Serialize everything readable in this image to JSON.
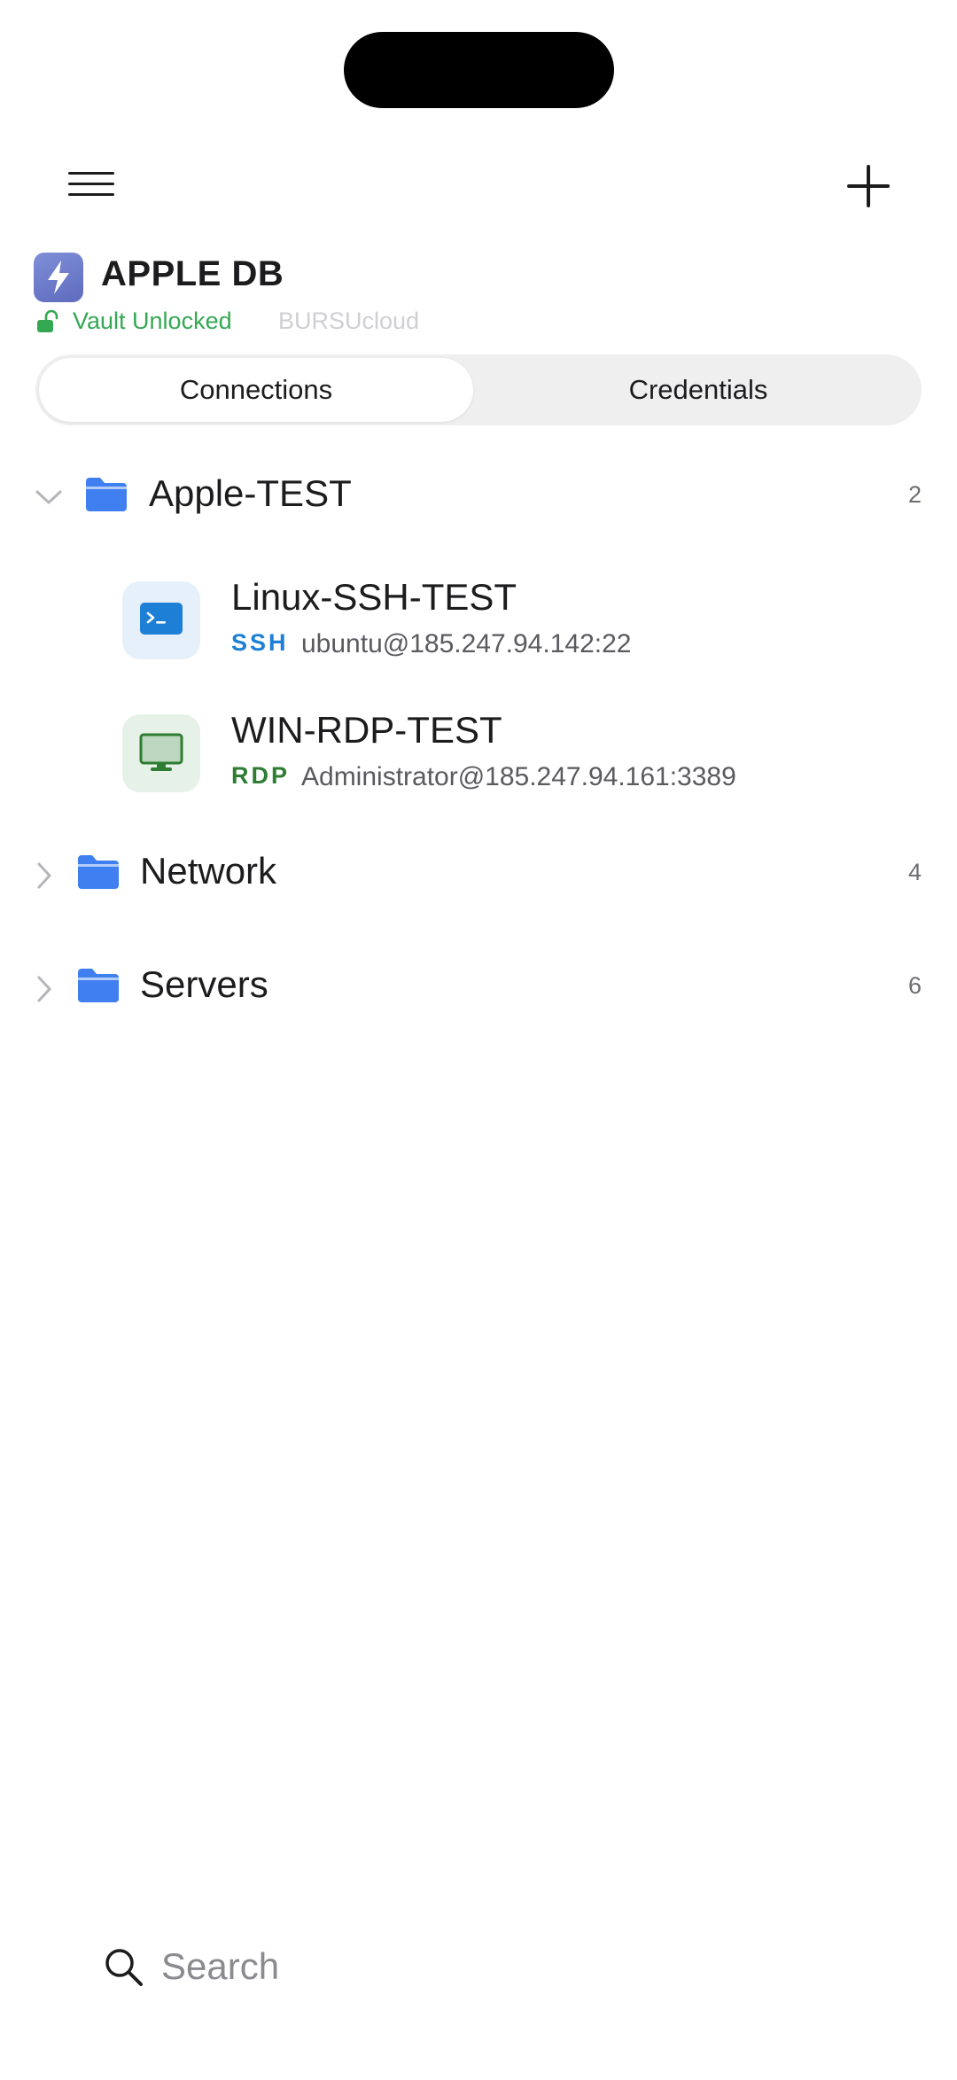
{
  "vault": {
    "title": "APPLE DB",
    "status": "Vault Unlocked",
    "account": "BURSUcloud"
  },
  "tabs": {
    "connections": "Connections",
    "credentials": "Credentials",
    "selected": "Connections"
  },
  "folders": [
    {
      "name": "Apple-TEST",
      "count": "2",
      "expanded": true,
      "connections": [
        {
          "name": "Linux-SSH-TEST",
          "protocol": "SSH",
          "address": "ubuntu@185.247.94.142:22",
          "icon": "terminal-icon"
        },
        {
          "name": "WIN-RDP-TEST",
          "protocol": "RDP",
          "address": "Administrator@185.247.94.161:3389",
          "icon": "monitor-icon"
        }
      ]
    },
    {
      "name": "Network",
      "count": "4",
      "expanded": false
    },
    {
      "name": "Servers",
      "count": "6",
      "expanded": false
    }
  ],
  "search": {
    "placeholder": "Search",
    "value": ""
  },
  "colors": {
    "accent_blue": "#3f7ff0",
    "unlocked_green": "#34a853",
    "ssh_blue": "#1e7fd6",
    "rdp_green": "#2e7d32"
  }
}
